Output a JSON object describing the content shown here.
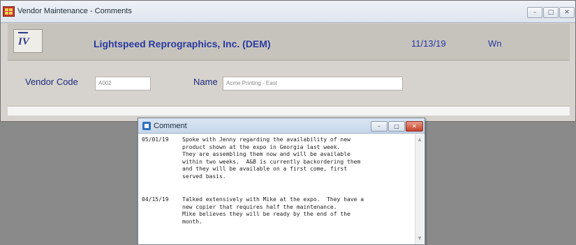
{
  "window": {
    "title": "Vendor Maintenance - Comments",
    "minimize_glyph": "–",
    "maximize_glyph": "□",
    "close_glyph": "✕"
  },
  "header": {
    "logo_text": "IV",
    "company": "Lightspeed Reprographics, Inc. (DEM)",
    "date": "11/13/19",
    "user": "Wn"
  },
  "form": {
    "vendor_code_label": "Vendor Code",
    "vendor_code_value": "A002",
    "name_label": "Name",
    "name_value": "Acme Printing - East"
  },
  "comment_dialog": {
    "title": "Comment",
    "minimize_glyph": "–",
    "maximize_glyph": "□",
    "close_glyph": "✕",
    "scroll_up_glyph": "▲",
    "scroll_down_glyph": "▼",
    "entries": [
      {
        "date": "05/01/19",
        "text": "Spoke with Jenny regarding the availability of new\nproduct shown at the expo in Georgia last week.\nThey are assembling them now and will be available\nwithin two weeks.  A&B is currently backordering them\nand they will be available on a first come, first\nserved basis."
      },
      {
        "date": "04/15/19",
        "text": "Talked extensively with Mike at the expo.  They have a\nnew copier that requires half the maintenance.\nMike believes they will be ready by the end of the\nmonth."
      }
    ]
  },
  "colors": {
    "background": "#8a8a8a",
    "header_text": "#2a3a9e",
    "label_text": "#1c2a7c"
  }
}
